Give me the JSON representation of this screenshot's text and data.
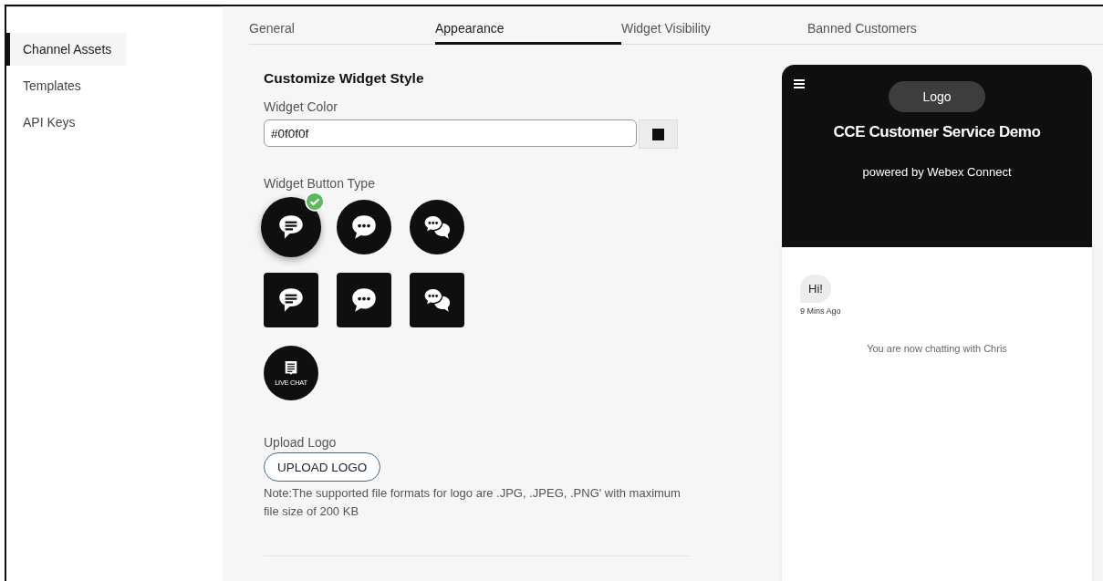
{
  "sidebar": {
    "items": [
      {
        "label": "Channel Assets",
        "selected": true
      },
      {
        "label": "Templates",
        "selected": false
      },
      {
        "label": "API Keys",
        "selected": false
      }
    ]
  },
  "tabs": [
    {
      "label": "General",
      "selected": false
    },
    {
      "label": "Appearance",
      "selected": true
    },
    {
      "label": "Widget Visibility",
      "selected": false
    },
    {
      "label": "Banned Customers",
      "selected": false
    }
  ],
  "section_title": "Customize Widget Style",
  "widget_color": {
    "label": "Widget Color",
    "value": "#0f0f0f"
  },
  "button_type": {
    "label": "Widget Button Type",
    "options": [
      {
        "kind": "round",
        "selected": true
      },
      {
        "kind": "round",
        "selected": false
      },
      {
        "kind": "round",
        "selected": false
      },
      {
        "kind": "square",
        "selected": false
      },
      {
        "kind": "square",
        "selected": false
      },
      {
        "kind": "square",
        "selected": false
      },
      {
        "kind": "label",
        "selected": false,
        "caption": "LIVE CHAT"
      }
    ]
  },
  "upload": {
    "label": "Upload Logo",
    "button": "UPLOAD LOGO",
    "note": "Note:The supported file formats for logo are .JPG, .JPEG, .PNG' with maximum file size of 200 KB"
  },
  "preview": {
    "logo": "Logo",
    "title": "CCE Customer Service Demo",
    "subtitle": "powered by Webex Connect",
    "messages": [
      {
        "text": "Hi!",
        "time": "9 Mins Ago"
      }
    ],
    "status": "You are now chatting with Chris"
  }
}
